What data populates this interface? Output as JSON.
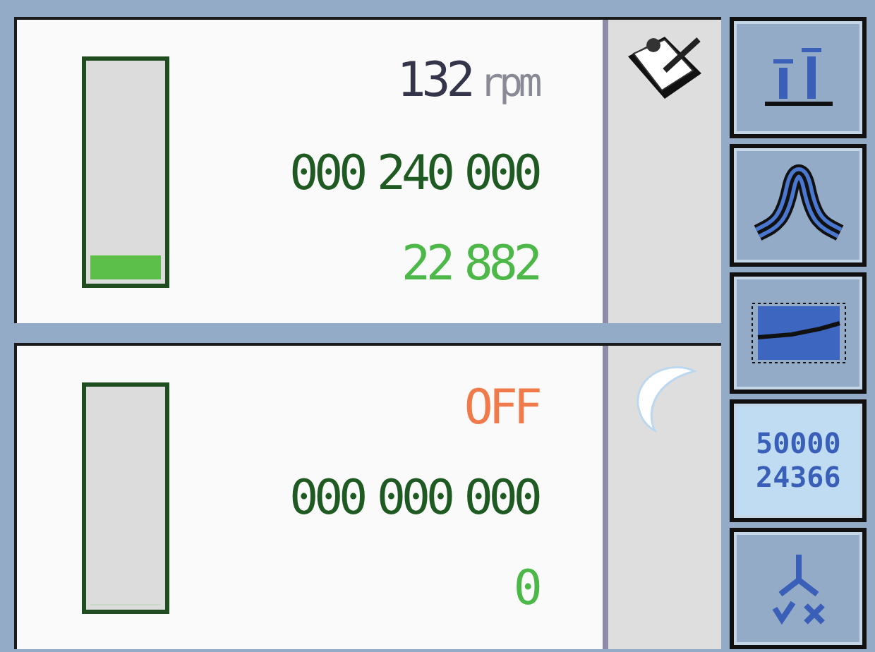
{
  "stations": [
    {
      "gauge": {
        "level": 0.11
      },
      "status": {
        "kind": "running",
        "value": "132",
        "unit": "rpm"
      },
      "total": "000 240 000",
      "count": "22 882",
      "side_icon": {
        "kind": "clipboard"
      }
    },
    {
      "gauge": {
        "level": 0
      },
      "status": {
        "kind": "off",
        "value": "OFF"
      },
      "total": "000 000 000",
      "count": "0",
      "side_icon": {
        "kind": "moon"
      }
    }
  ],
  "sidebar": [
    {
      "kind": "bars",
      "selected": false
    },
    {
      "kind": "peak",
      "selected": false
    },
    {
      "kind": "trend",
      "selected": false
    },
    {
      "kind": "counter",
      "selected": true,
      "lines": [
        "50000",
        "24366"
      ]
    },
    {
      "kind": "split",
      "selected": false
    }
  ]
}
